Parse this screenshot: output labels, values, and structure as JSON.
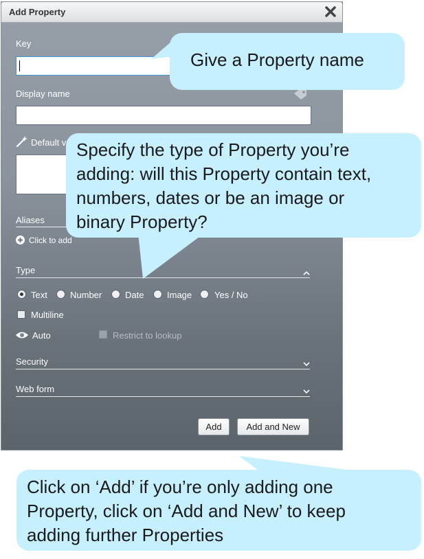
{
  "dialog": {
    "title": "Add Property",
    "key_label": "Key",
    "key_value": "",
    "display_name_label": "Display name",
    "display_name_value": "",
    "default_value_label": "Default v",
    "aliases_label": "Aliases",
    "click_to_add": "Click to add",
    "type_label": "Type",
    "type_options": [
      "Text",
      "Number",
      "Date",
      "Image",
      "Yes / No"
    ],
    "type_selected": "Text",
    "multiline_label": "Multiline",
    "auto_label": "Auto",
    "restrict_label": "Restrict to lookup",
    "security_label": "Security",
    "web_form_label": "Web form",
    "add_button": "Add",
    "add_new_button": "Add and New"
  },
  "callouts": {
    "name": "Give a Property name",
    "type_line1": "Specify the type of Property you’re",
    "type_line2": "adding: will this Property contain text,",
    "type_line3": "numbers, dates or be an image or",
    "type_line4": "binary Property?",
    "add_line1": "Click on ‘Add’ if you’re only adding one",
    "add_line2": "Property, click on ‘Add and New’ to keep",
    "add_line3": "adding further Properties"
  },
  "colors": {
    "callout_bg": "#c6efff",
    "dialog_top": "#97a0a9",
    "dialog_bottom": "#5b636b"
  }
}
